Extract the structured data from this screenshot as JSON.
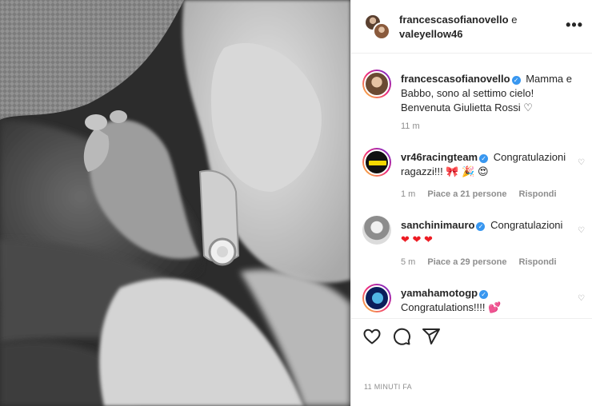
{
  "header": {
    "user1": "francescasofianovello",
    "conjunction": "e",
    "user2": "valeyellow46",
    "more_icon": "more-horizontal-icon"
  },
  "caption": {
    "username": "francescasofianovello",
    "text": "Mamma e Babbo, sono al settimo cielo! Benvenuta Giulietta Rossi ♡",
    "time": "11 m"
  },
  "comments": [
    {
      "username": "vr46racingteam",
      "text": "Congratulazioni ragazzi!!! 🎀 🎉 😍",
      "time": "1 m",
      "likes": "Piace a 21 persone",
      "reply": "Rispondi"
    },
    {
      "username": "sanchinimauro",
      "text": "Congratulazioni",
      "hearts": "❤ ❤ ❤",
      "time": "5 m",
      "likes": "Piace a 29 persone",
      "reply": "Rispondi"
    },
    {
      "username": "yamahamotogp",
      "text": "Congratulations!!!! 💕"
    }
  ],
  "actions": {
    "like_icon": "heart-icon",
    "comment_icon": "comment-icon",
    "share_icon": "share-icon"
  },
  "timestamp": "11 MINUTI FA",
  "colors": {
    "verified": "#3897f0",
    "meta_text": "#8e8e8e",
    "border": "#efefef"
  }
}
